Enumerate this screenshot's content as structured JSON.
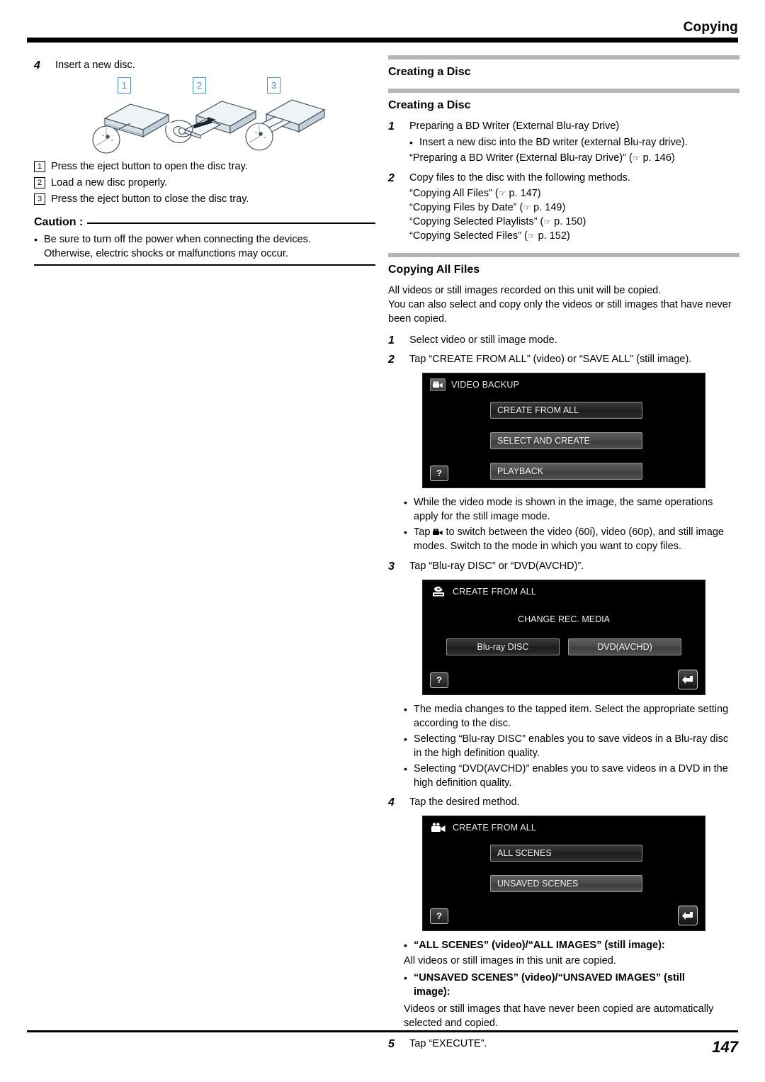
{
  "header": {
    "title": "Copying"
  },
  "footer": {
    "page_number": "147"
  },
  "left": {
    "step4": {
      "num": "4",
      "text": "Insert a new disc."
    },
    "callouts": [
      "1",
      "2",
      "3"
    ],
    "mini_list": [
      {
        "num": "1",
        "text": "Press the eject button to open the disc tray."
      },
      {
        "num": "2",
        "text": "Load a new disc properly."
      },
      {
        "num": "3",
        "text": "Press the eject button to close the disc tray."
      }
    ],
    "caution": {
      "label": "Caution :",
      "line1": "Be sure to turn off the power when connecting the devices.",
      "line2": "Otherwise, electric shocks or malfunctions may occur."
    }
  },
  "right": {
    "section_creating_disc_1": "Creating a Disc",
    "section_creating_disc_2": "Creating a Disc",
    "steps_creating": [
      {
        "num": "1",
        "text": "Preparing a BD Writer (External Blu-ray Drive)",
        "bullet": "Insert a new disc into the BD writer (external Blu-ray drive).",
        "ref": "“Preparing a BD Writer (External Blu-ray Drive)” (",
        "ref_tail": " p. 146)"
      },
      {
        "num": "2",
        "text": "Copy files to the disc with the following methods.",
        "refs": [
          {
            "label": "“Copying All Files” (",
            "tail": " p. 147)"
          },
          {
            "label": "“Copying Files by Date” (",
            "tail": " p. 149)"
          },
          {
            "label": "“Copying Selected Playlists” (",
            "tail": " p. 150)"
          },
          {
            "label": "“Copying Selected Files” (",
            "tail": " p. 152)"
          }
        ]
      }
    ],
    "section_copying_all_files": "Copying All Files",
    "intro": {
      "line1": "All videos or still images recorded on this unit will be copied.",
      "line2": "You can also select and copy only the videos or still images that have never",
      "line3": "been copied."
    },
    "step1": {
      "num": "1",
      "text": "Select video or still image mode."
    },
    "step2": {
      "num": "2",
      "text": "Tap “CREATE FROM ALL” (video) or “SAVE ALL” (still image)."
    },
    "screen_video_backup": {
      "icon": "video-camera-icon",
      "title": "VIDEO BACKUP",
      "buttons": [
        {
          "label": "CREATE FROM ALL",
          "selected": true
        },
        {
          "label": "SELECT AND CREATE",
          "selected": false
        },
        {
          "label": "PLAYBACK",
          "selected": false
        }
      ],
      "help_label": "?"
    },
    "notes_after_screen1": [
      "While the video mode is shown in the image, the same operations apply for the still image mode.",
      "Tap  [video-camera-icon]  to switch between the video (60i), video (60p), and still image modes. Switch to the mode in which you want to copy files."
    ],
    "note2_part1": "Tap ",
    "note2_part2": " to switch between the video (60i), video (60p), and still image",
    "note2_line2": "modes. Switch to the mode in which you want to copy files.",
    "step3": {
      "num": "3",
      "text": "Tap “Blu-ray DISC” or “DVD(AVCHD)”."
    },
    "screen_change_media": {
      "icon": "disc-drive-icon",
      "title": "CREATE FROM ALL",
      "subtitle": "CHANGE REC. MEDIA",
      "buttons": [
        {
          "label": "Blu-ray DISC",
          "selected": true
        },
        {
          "label": "DVD(AVCHD)",
          "selected": false
        }
      ],
      "help_label": "?",
      "back_label": "back-arrow-icon"
    },
    "notes_after_screen2": [
      {
        "l1": "The media changes to the tapped item. Select the appropriate setting",
        "l2": "according to the disc."
      },
      {
        "l1": "Selecting “Blu-ray DISC” enables you to save videos in a Blu-ray disc",
        "l2": "in the high definition quality."
      },
      {
        "l1": "Selecting “DVD(AVCHD)” enables you to save videos in a DVD in the",
        "l2": "high definition quality."
      }
    ],
    "step4": {
      "num": "4",
      "text": "Tap the desired method."
    },
    "screen_create_from_all": {
      "icon": "video-camera-icon",
      "title": "CREATE FROM ALL",
      "buttons": [
        {
          "label": "ALL SCENES",
          "selected": true
        },
        {
          "label": "UNSAVED SCENES",
          "selected": false
        }
      ],
      "help_label": "?",
      "back_label": "back-arrow-icon"
    },
    "defs": [
      {
        "term": "“ALL SCENES” (video)/“ALL IMAGES” (still image):",
        "desc": "All videos or still images in this unit are copied."
      },
      {
        "term_l1": "“UNSAVED SCENES” (video)/“UNSAVED IMAGES” (still",
        "term_l2": "image):",
        "desc_l1": "Videos or still images that have never been copied are automatically",
        "desc_l2": "selected and copied."
      }
    ],
    "step5": {
      "num": "5",
      "text": "Tap “EXECUTE”."
    }
  }
}
